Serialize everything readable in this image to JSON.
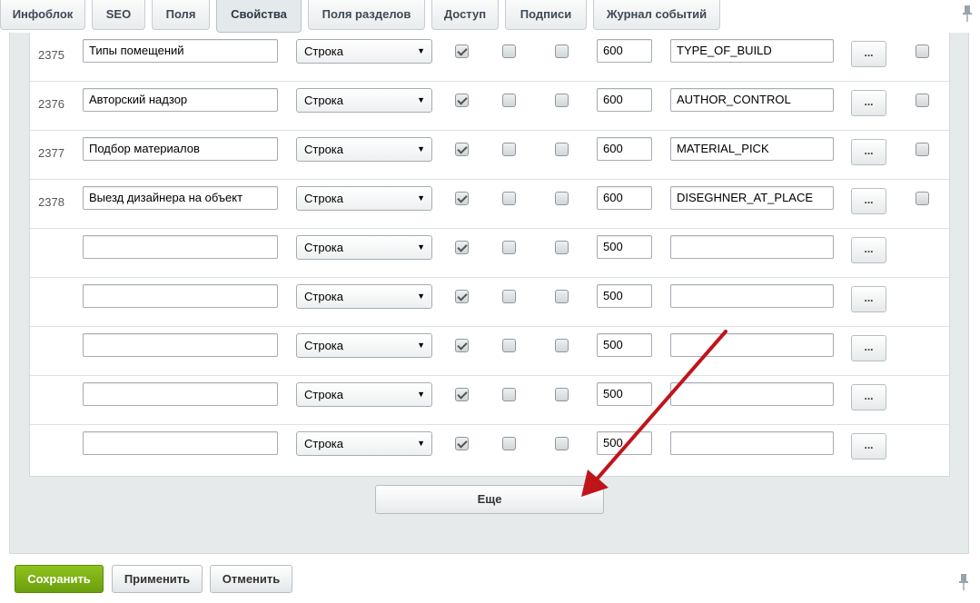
{
  "tabs": [
    {
      "label": "Инфоблок"
    },
    {
      "label": "SEO"
    },
    {
      "label": "Поля"
    },
    {
      "label": "Свойства"
    },
    {
      "label": "Поля разделов"
    },
    {
      "label": "Доступ"
    },
    {
      "label": "Подписи"
    },
    {
      "label": "Журнал событий"
    }
  ],
  "rows": [
    {
      "id": "2375",
      "name": "Типы помещений",
      "type": "Строка",
      "sort": "600",
      "code": "TYPE_OF_BUILD",
      "checks": [
        true,
        false,
        false
      ],
      "delete": false
    },
    {
      "id": "2376",
      "name": "Авторский надзор",
      "type": "Строка",
      "sort": "600",
      "code": "AUTHOR_CONTROL",
      "checks": [
        true,
        false,
        false
      ],
      "delete": false
    },
    {
      "id": "2377",
      "name": "Подбор материалов",
      "type": "Строка",
      "sort": "600",
      "code": "MATERIAL_PICK",
      "checks": [
        true,
        false,
        false
      ],
      "delete": false
    },
    {
      "id": "2378",
      "name": "Выезд дизайнера на объект",
      "type": "Строка",
      "sort": "600",
      "code": "DISEGHNER_AT_PLACE",
      "checks": [
        true,
        false,
        false
      ],
      "delete": false
    },
    {
      "id": "",
      "name": "",
      "type": "Строка",
      "sort": "500",
      "code": "",
      "checks": [
        true,
        false,
        false
      ]
    },
    {
      "id": "",
      "name": "",
      "type": "Строка",
      "sort": "500",
      "code": "",
      "checks": [
        true,
        false,
        false
      ]
    },
    {
      "id": "",
      "name": "",
      "type": "Строка",
      "sort": "500",
      "code": "",
      "checks": [
        true,
        false,
        false
      ]
    },
    {
      "id": "",
      "name": "",
      "type": "Строка",
      "sort": "500",
      "code": "",
      "checks": [
        true,
        false,
        false
      ]
    },
    {
      "id": "",
      "name": "",
      "type": "Строка",
      "sort": "500",
      "code": "",
      "checks": [
        true,
        false,
        false
      ]
    }
  ],
  "edit_button_label": "...",
  "more_button_label": "Еще",
  "footer": {
    "save_label": "Сохранить",
    "apply_label": "Применить",
    "cancel_label": "Отменить"
  },
  "colors": {
    "accent_green": "#7cb10f",
    "arrow_red": "#c0141b"
  },
  "icons": {
    "pin": "pin-icon",
    "arrow": "red-arrow-annotation"
  }
}
